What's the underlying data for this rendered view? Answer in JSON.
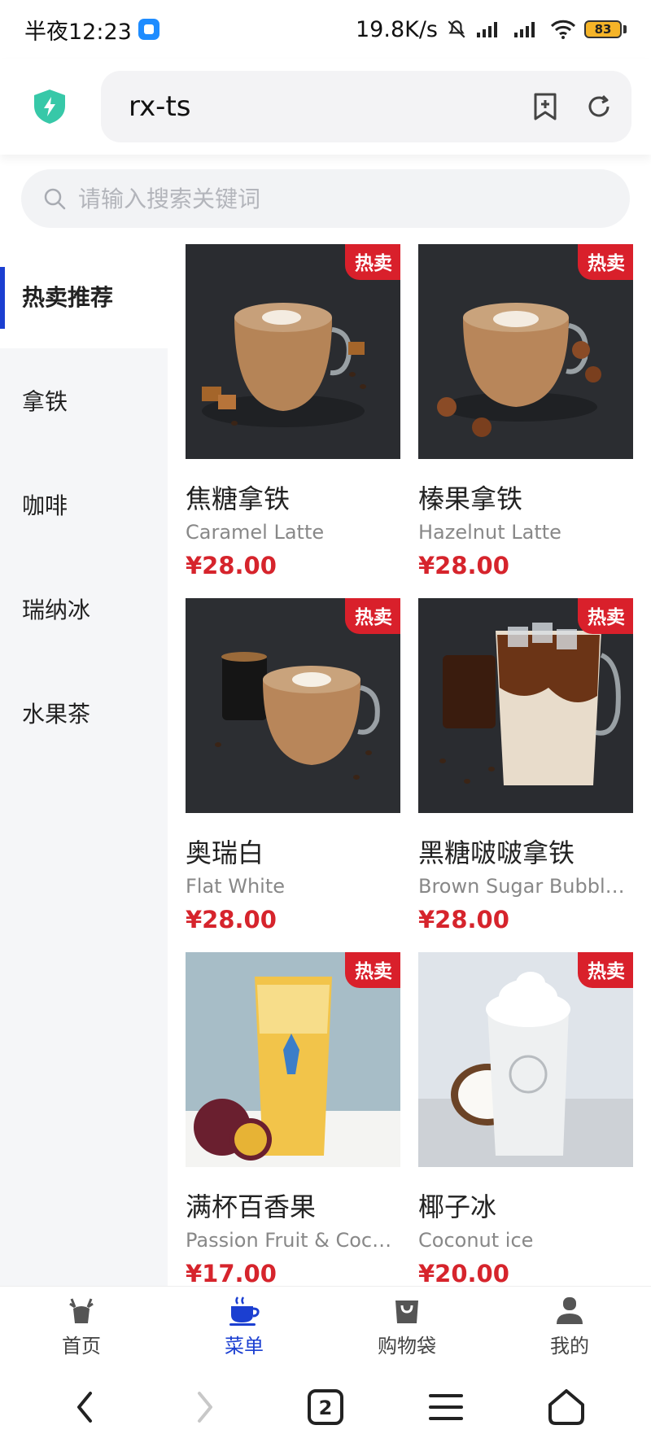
{
  "status": {
    "time": "半夜12:23",
    "speed": "19.8K/s",
    "battery": "83"
  },
  "browser": {
    "url": "rx-ts"
  },
  "search": {
    "placeholder": "请输入搜索关键词"
  },
  "categories": [
    {
      "label": "热卖推荐",
      "active": true
    },
    {
      "label": "拿铁",
      "active": false
    },
    {
      "label": "咖啡",
      "active": false
    },
    {
      "label": "瑞纳冰",
      "active": false
    },
    {
      "label": "水果茶",
      "active": false
    }
  ],
  "products": [
    {
      "name": "焦糖拿铁",
      "en": "Caramel Latte",
      "price": "¥28.00",
      "badge": "热卖"
    },
    {
      "name": "榛果拿铁",
      "en": "Hazelnut Latte",
      "price": "¥28.00",
      "badge": "热卖"
    },
    {
      "name": "奥瑞白",
      "en": "Flat White",
      "price": "¥28.00",
      "badge": "热卖"
    },
    {
      "name": "黑糖啵啵拿铁",
      "en": "Brown Sugar Bubbl…",
      "price": "¥28.00",
      "badge": "热卖"
    },
    {
      "name": "满杯百香果",
      "en": "Passion Fruit & Coc…",
      "price": "¥17.00",
      "badge": "热卖"
    },
    {
      "name": "椰子冰",
      "en": "Coconut ice",
      "price": "¥20.00",
      "badge": "热卖"
    }
  ],
  "tabs": [
    {
      "label": "首页",
      "icon": "deer-icon",
      "active": false
    },
    {
      "label": "菜单",
      "icon": "coffee-cup-icon",
      "active": true
    },
    {
      "label": "购物袋",
      "icon": "bag-icon",
      "active": false
    },
    {
      "label": "我的",
      "icon": "user-icon",
      "active": false
    }
  ],
  "sysnav": {
    "tab_count": "2"
  },
  "colors": {
    "accent": "#1b3fd1",
    "price": "#d6242c",
    "badge": "#d9202b"
  }
}
